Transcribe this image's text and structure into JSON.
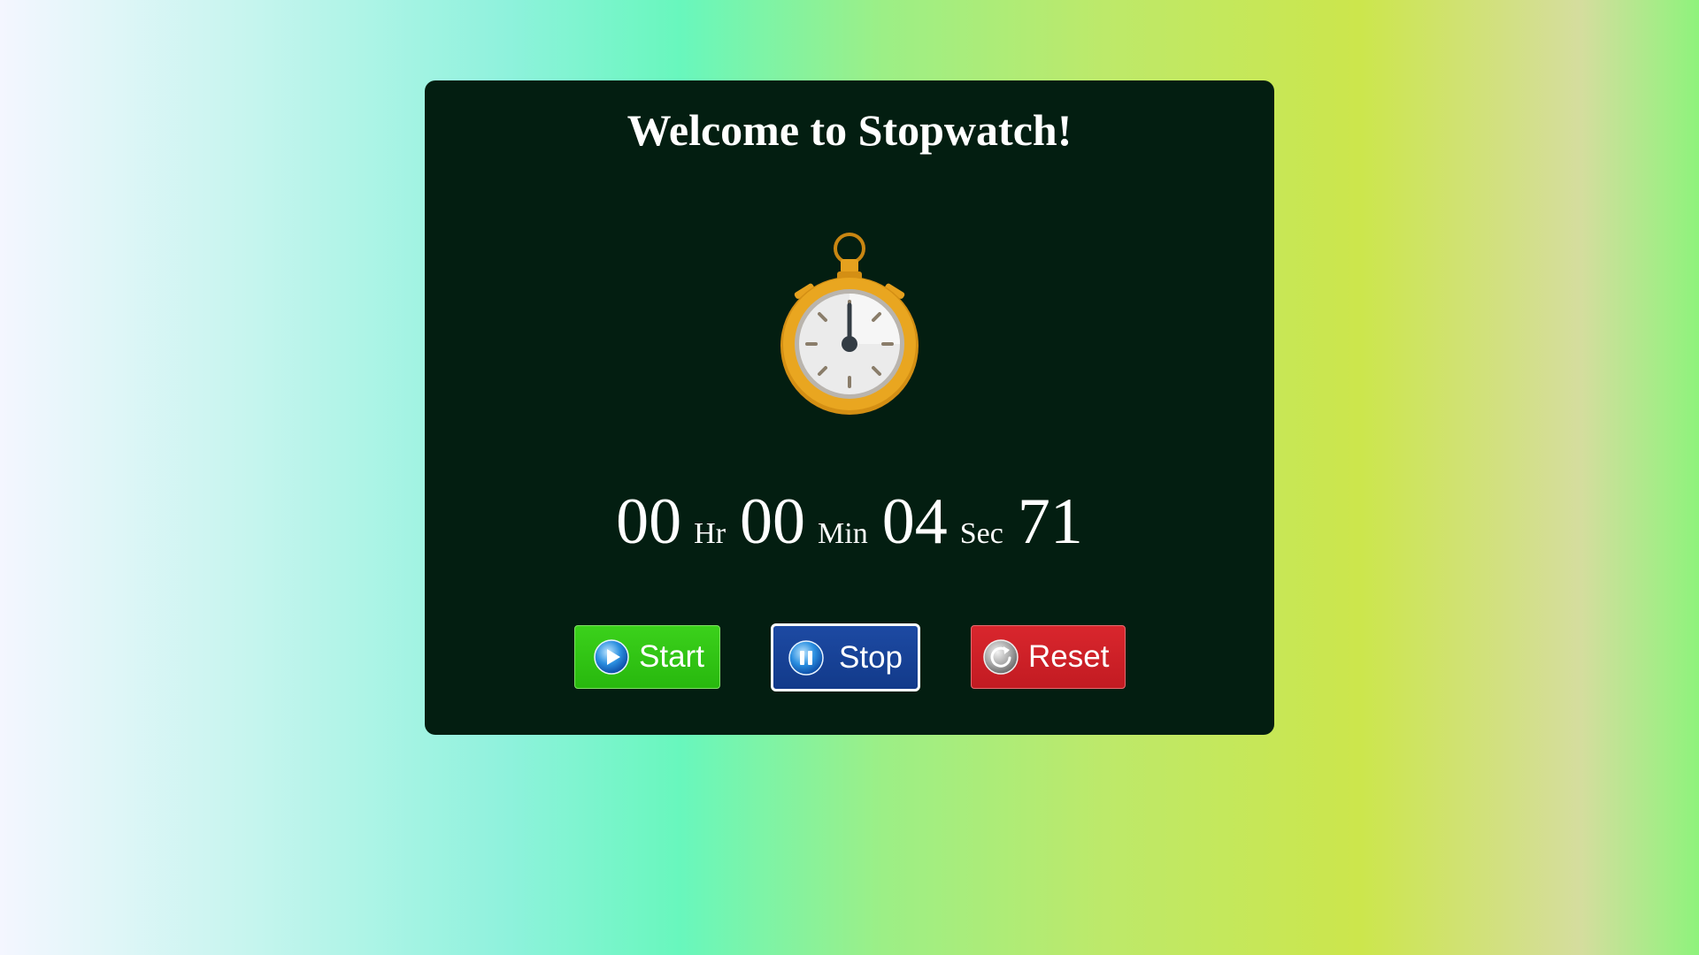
{
  "page": {
    "title": "Welcome to Stopwatch!"
  },
  "stopwatch": {
    "icon": "stopwatch-icon",
    "hours": "00",
    "hours_unit": "Hr",
    "minutes": "00",
    "minutes_unit": "Min",
    "seconds": "04",
    "seconds_unit": "Sec",
    "hundredths": "71"
  },
  "controls": {
    "start_label": "Start",
    "start_icon": "play-icon",
    "stop_label": "Stop",
    "stop_icon": "pause-icon",
    "reset_label": "Reset",
    "reset_icon": "reset-icon"
  },
  "colors": {
    "panel": "#031e11",
    "start": "#2cbf12",
    "stop": "#153d8f",
    "reset": "#cf2128",
    "watch_gold": "#e6a11e"
  }
}
